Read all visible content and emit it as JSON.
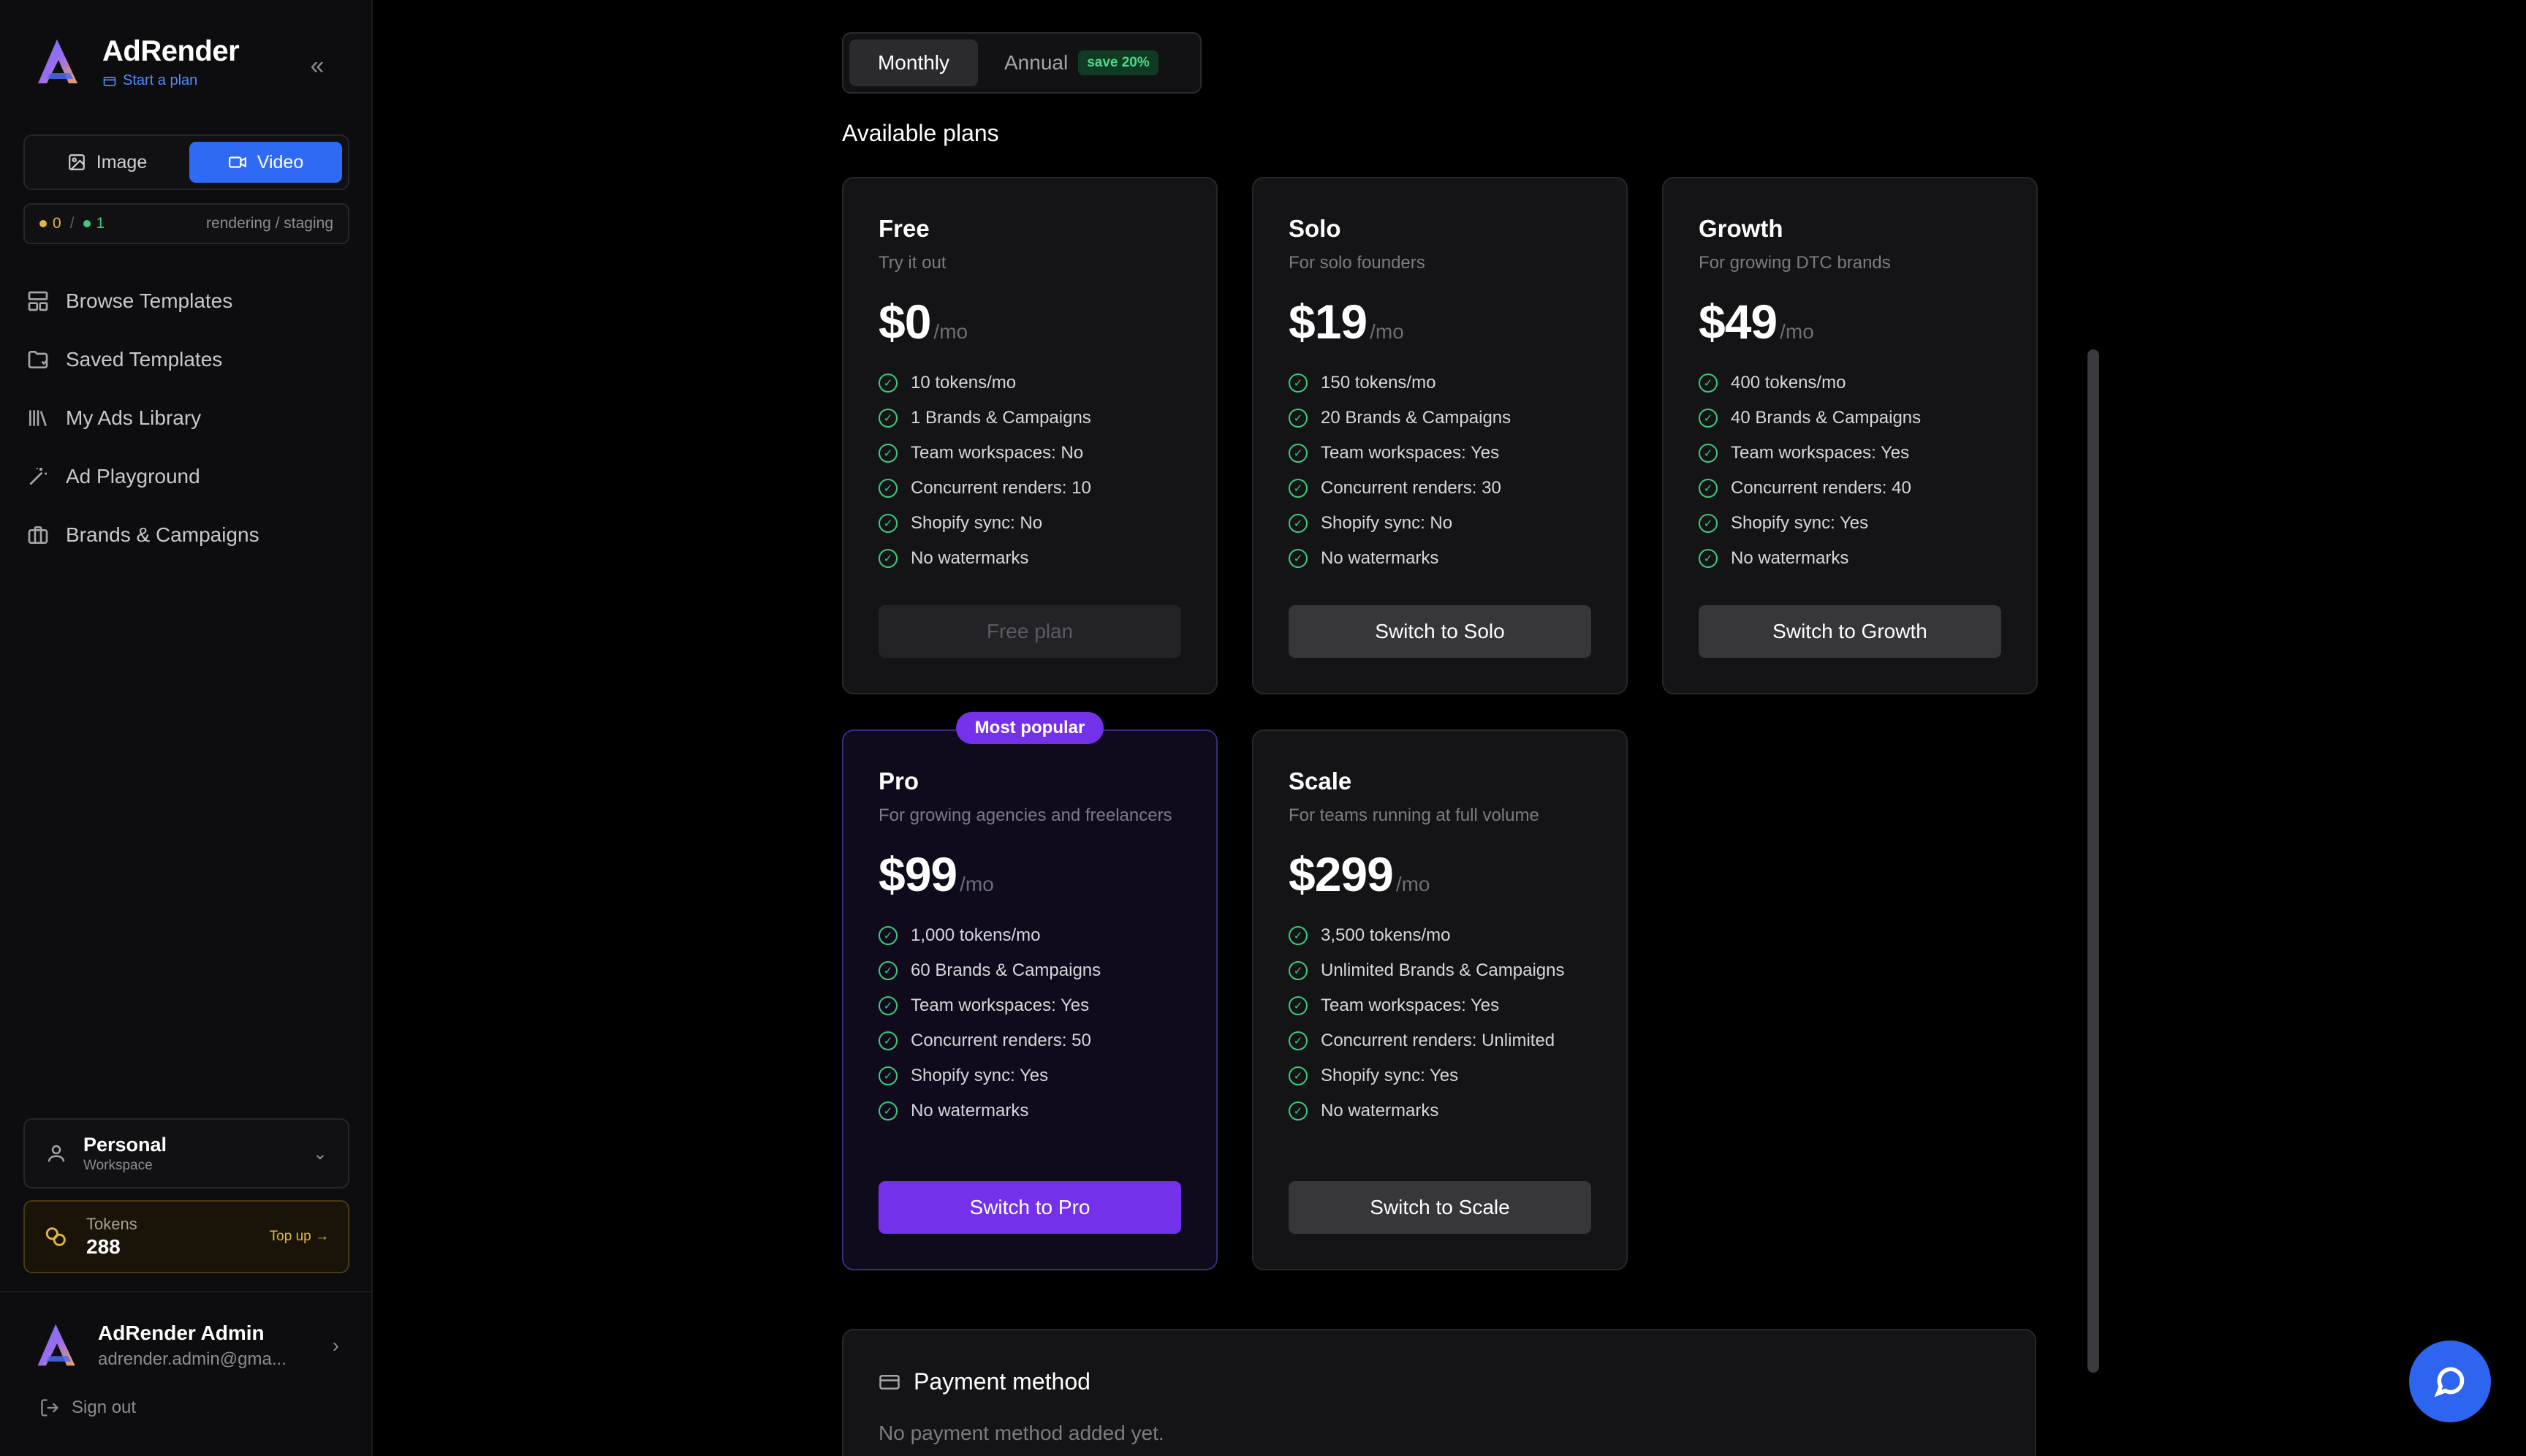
{
  "sidebar": {
    "brand": "AdRender",
    "brand_sub": "Start a plan",
    "collapse_icon": "chevrons-left-icon",
    "mode": {
      "image_label": "Image",
      "video_label": "Video",
      "active": "video"
    },
    "status": {
      "active_count": "0",
      "separator": "/",
      "queued_count": "1",
      "label": "rendering / staging"
    },
    "nav": [
      {
        "label": "Browse Templates",
        "icon": "layout-icon"
      },
      {
        "label": "Saved Templates",
        "icon": "folder-icon"
      },
      {
        "label": "My Ads Library",
        "icon": "library-icon"
      },
      {
        "label": "Ad Playground",
        "icon": "wand-icon"
      },
      {
        "label": "Brands & Campaigns",
        "icon": "briefcase-icon"
      }
    ],
    "workspace": {
      "name": "Personal",
      "sub": "Workspace"
    },
    "tokens": {
      "label": "Tokens",
      "value": "288",
      "topup": "Top up →"
    },
    "user": {
      "name": "AdRender Admin",
      "email": "adrender.admin@gma..."
    },
    "signout": "Sign out"
  },
  "billing": {
    "monthly": "Monthly",
    "annual": "Annual",
    "save": "save 20%",
    "active": "monthly"
  },
  "section_title": "Available plans",
  "plans": [
    {
      "name": "Free",
      "desc": "Try it out",
      "price": "$0",
      "unit": "/mo",
      "features": [
        "10 tokens/mo",
        "1 Brands & Campaigns",
        "Team workspaces: No",
        "Concurrent renders: 10",
        "Shopify sync: No",
        "No watermarks"
      ],
      "button": "Free plan",
      "button_state": "disabled"
    },
    {
      "name": "Solo",
      "desc": "For solo founders",
      "price": "$19",
      "unit": "/mo",
      "features": [
        "150 tokens/mo",
        "20 Brands & Campaigns",
        "Team workspaces: Yes",
        "Concurrent renders: 30",
        "Shopify sync: No",
        "No watermarks"
      ],
      "button": "Switch to Solo",
      "button_state": "default"
    },
    {
      "name": "Growth",
      "desc": "For growing DTC brands",
      "price": "$49",
      "unit": "/mo",
      "features": [
        "400 tokens/mo",
        "40 Brands & Campaigns",
        "Team workspaces: Yes",
        "Concurrent renders: 40",
        "Shopify sync: Yes",
        "No watermarks"
      ],
      "button": "Switch to Growth",
      "button_state": "default"
    },
    {
      "name": "Pro",
      "badge": "Most popular",
      "desc": "For growing agencies and freelancers",
      "price": "$99",
      "unit": "/mo",
      "features": [
        "1,000 tokens/mo",
        "60 Brands & Campaigns",
        "Team workspaces: Yes",
        "Concurrent renders: 50",
        "Shopify sync: Yes",
        "No watermarks"
      ],
      "button": "Switch to Pro",
      "button_state": "primary"
    },
    {
      "name": "Scale",
      "desc": "For teams running at full volume",
      "price": "$299",
      "unit": "/mo",
      "features": [
        "3,500 tokens/mo",
        "Unlimited Brands & Campaigns",
        "Team workspaces: Yes",
        "Concurrent renders: Unlimited",
        "Shopify sync: Yes",
        "No watermarks"
      ],
      "button": "Switch to Scale",
      "button_state": "default"
    }
  ],
  "payment": {
    "title": "Payment method",
    "empty": "No payment method added yet."
  },
  "colors": {
    "accent": "#2f6bf2",
    "pro": "#7331ea",
    "check": "#3ec97b",
    "token": "#e5b546"
  }
}
